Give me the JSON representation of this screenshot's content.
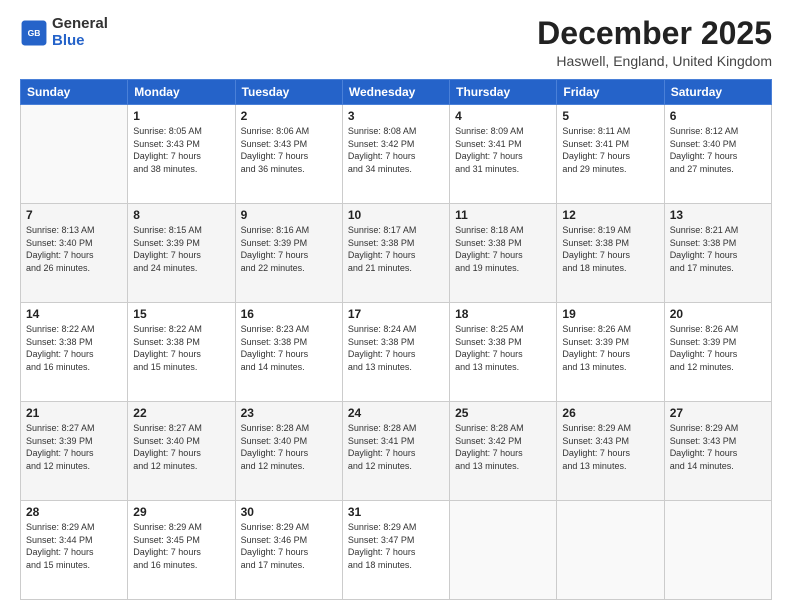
{
  "logo": {
    "line1": "General",
    "line2": "Blue"
  },
  "header": {
    "month": "December 2025",
    "location": "Haswell, England, United Kingdom"
  },
  "days_of_week": [
    "Sunday",
    "Monday",
    "Tuesday",
    "Wednesday",
    "Thursday",
    "Friday",
    "Saturday"
  ],
  "weeks": [
    [
      {
        "day": "",
        "info": ""
      },
      {
        "day": "1",
        "info": "Sunrise: 8:05 AM\nSunset: 3:43 PM\nDaylight: 7 hours\nand 38 minutes."
      },
      {
        "day": "2",
        "info": "Sunrise: 8:06 AM\nSunset: 3:43 PM\nDaylight: 7 hours\nand 36 minutes."
      },
      {
        "day": "3",
        "info": "Sunrise: 8:08 AM\nSunset: 3:42 PM\nDaylight: 7 hours\nand 34 minutes."
      },
      {
        "day": "4",
        "info": "Sunrise: 8:09 AM\nSunset: 3:41 PM\nDaylight: 7 hours\nand 31 minutes."
      },
      {
        "day": "5",
        "info": "Sunrise: 8:11 AM\nSunset: 3:41 PM\nDaylight: 7 hours\nand 29 minutes."
      },
      {
        "day": "6",
        "info": "Sunrise: 8:12 AM\nSunset: 3:40 PM\nDaylight: 7 hours\nand 27 minutes."
      }
    ],
    [
      {
        "day": "7",
        "info": "Sunrise: 8:13 AM\nSunset: 3:40 PM\nDaylight: 7 hours\nand 26 minutes."
      },
      {
        "day": "8",
        "info": "Sunrise: 8:15 AM\nSunset: 3:39 PM\nDaylight: 7 hours\nand 24 minutes."
      },
      {
        "day": "9",
        "info": "Sunrise: 8:16 AM\nSunset: 3:39 PM\nDaylight: 7 hours\nand 22 minutes."
      },
      {
        "day": "10",
        "info": "Sunrise: 8:17 AM\nSunset: 3:38 PM\nDaylight: 7 hours\nand 21 minutes."
      },
      {
        "day": "11",
        "info": "Sunrise: 8:18 AM\nSunset: 3:38 PM\nDaylight: 7 hours\nand 19 minutes."
      },
      {
        "day": "12",
        "info": "Sunrise: 8:19 AM\nSunset: 3:38 PM\nDaylight: 7 hours\nand 18 minutes."
      },
      {
        "day": "13",
        "info": "Sunrise: 8:21 AM\nSunset: 3:38 PM\nDaylight: 7 hours\nand 17 minutes."
      }
    ],
    [
      {
        "day": "14",
        "info": "Sunrise: 8:22 AM\nSunset: 3:38 PM\nDaylight: 7 hours\nand 16 minutes."
      },
      {
        "day": "15",
        "info": "Sunrise: 8:22 AM\nSunset: 3:38 PM\nDaylight: 7 hours\nand 15 minutes."
      },
      {
        "day": "16",
        "info": "Sunrise: 8:23 AM\nSunset: 3:38 PM\nDaylight: 7 hours\nand 14 minutes."
      },
      {
        "day": "17",
        "info": "Sunrise: 8:24 AM\nSunset: 3:38 PM\nDaylight: 7 hours\nand 13 minutes."
      },
      {
        "day": "18",
        "info": "Sunrise: 8:25 AM\nSunset: 3:38 PM\nDaylight: 7 hours\nand 13 minutes."
      },
      {
        "day": "19",
        "info": "Sunrise: 8:26 AM\nSunset: 3:39 PM\nDaylight: 7 hours\nand 13 minutes."
      },
      {
        "day": "20",
        "info": "Sunrise: 8:26 AM\nSunset: 3:39 PM\nDaylight: 7 hours\nand 12 minutes."
      }
    ],
    [
      {
        "day": "21",
        "info": "Sunrise: 8:27 AM\nSunset: 3:39 PM\nDaylight: 7 hours\nand 12 minutes."
      },
      {
        "day": "22",
        "info": "Sunrise: 8:27 AM\nSunset: 3:40 PM\nDaylight: 7 hours\nand 12 minutes."
      },
      {
        "day": "23",
        "info": "Sunrise: 8:28 AM\nSunset: 3:40 PM\nDaylight: 7 hours\nand 12 minutes."
      },
      {
        "day": "24",
        "info": "Sunrise: 8:28 AM\nSunset: 3:41 PM\nDaylight: 7 hours\nand 12 minutes."
      },
      {
        "day": "25",
        "info": "Sunrise: 8:28 AM\nSunset: 3:42 PM\nDaylight: 7 hours\nand 13 minutes."
      },
      {
        "day": "26",
        "info": "Sunrise: 8:29 AM\nSunset: 3:43 PM\nDaylight: 7 hours\nand 13 minutes."
      },
      {
        "day": "27",
        "info": "Sunrise: 8:29 AM\nSunset: 3:43 PM\nDaylight: 7 hours\nand 14 minutes."
      }
    ],
    [
      {
        "day": "28",
        "info": "Sunrise: 8:29 AM\nSunset: 3:44 PM\nDaylight: 7 hours\nand 15 minutes."
      },
      {
        "day": "29",
        "info": "Sunrise: 8:29 AM\nSunset: 3:45 PM\nDaylight: 7 hours\nand 16 minutes."
      },
      {
        "day": "30",
        "info": "Sunrise: 8:29 AM\nSunset: 3:46 PM\nDaylight: 7 hours\nand 17 minutes."
      },
      {
        "day": "31",
        "info": "Sunrise: 8:29 AM\nSunset: 3:47 PM\nDaylight: 7 hours\nand 18 minutes."
      },
      {
        "day": "",
        "info": ""
      },
      {
        "day": "",
        "info": ""
      },
      {
        "day": "",
        "info": ""
      }
    ]
  ]
}
